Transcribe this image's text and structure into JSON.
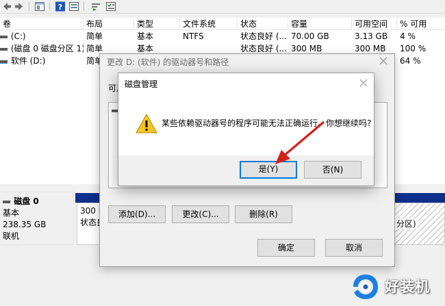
{
  "volume_list": {
    "columns": [
      "卷",
      "布局",
      "类型",
      "文件系统",
      "状态",
      "容量",
      "可用空间",
      "% 可用"
    ],
    "rows": [
      {
        "name": "(C:)",
        "layout": "简单",
        "type": "基本",
        "fs": "NTFS",
        "status": "状态良好 (...",
        "capacity": "70.00 GB",
        "free": "3.13 GB",
        "pct": "4 %"
      },
      {
        "name": "(磁盘 0 磁盘分区 1)",
        "layout": "简单",
        "type": "基本",
        "fs": "",
        "status": "状态良好 (...",
        "capacity": "300 MB",
        "free": "300 MB",
        "pct": "100 %"
      },
      {
        "name": "软件 (D:)",
        "layout": "简单",
        "type": "",
        "fs": "",
        "status": "",
        "capacity": "",
        "free": "",
        "pct": "64 %"
      }
    ]
  },
  "disk": {
    "name": "磁盘 0",
    "type": "基本",
    "size": "238.35 GB",
    "status": "联机",
    "partition1_line1": "300 M",
    "partition1_line2": "状态良",
    "partition_last_suffix": "分区)"
  },
  "change_dialog": {
    "title": "更改 D: (软件) 的驱动器号和路径",
    "label": "可用",
    "add_button": "添加(D)...",
    "change_button": "更改(C)...",
    "delete_button": "删除(R)",
    "ok_button": "确定",
    "cancel_button": "取消"
  },
  "confirm_dialog": {
    "title": "磁盘管理",
    "message": "某些依赖驱动器号的程序可能无法正确运行。你想继续吗?",
    "yes_button": "是(Y)",
    "no_button": "否(N)"
  },
  "watermark": {
    "text": "好装机"
  },
  "colors": {
    "disk_bar": "#0e2f8c",
    "arrow": "#d0211c",
    "focus": "#0078d7",
    "warning": "#f7c325"
  },
  "icons": {
    "toolbar": [
      "back-icon",
      "forward-icon",
      "console-tree-icon",
      "help-icon",
      "properties-icon",
      "rescan-icon",
      "list-icon"
    ]
  }
}
